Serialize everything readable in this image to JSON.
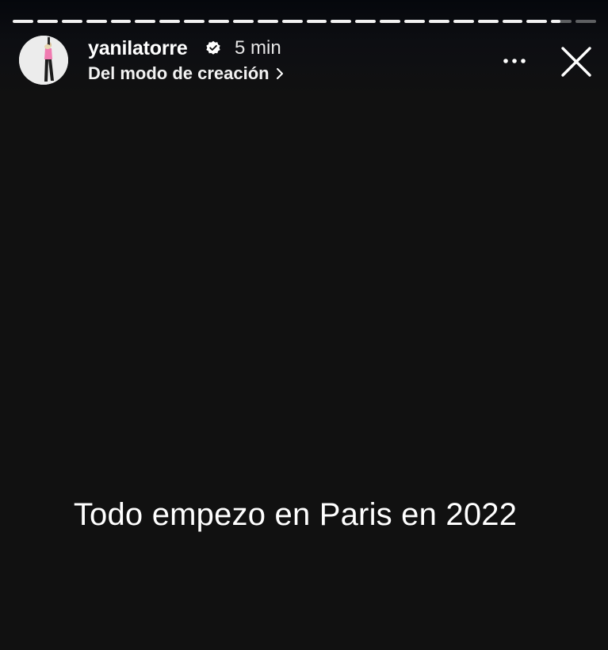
{
  "story": {
    "segments_total": 24,
    "segments_viewed": 22,
    "current_segment_progress": 0.45
  },
  "header": {
    "username": "yanilatorre",
    "verified_icon": "verified-badge-icon",
    "time_ago": "5 min",
    "subtitle": "Del modo de creación",
    "subtitle_icon": "chevron-right-icon",
    "more_icon": "more-horizontal-icon",
    "close_icon": "close-icon"
  },
  "content": {
    "caption": "Todo empezo en Paris en 2022"
  },
  "colors": {
    "background": "#111111",
    "text": "#ffffff",
    "progress_filled": "#f2f2f2",
    "progress_empty": "rgba(255,255,255,0.35)"
  }
}
